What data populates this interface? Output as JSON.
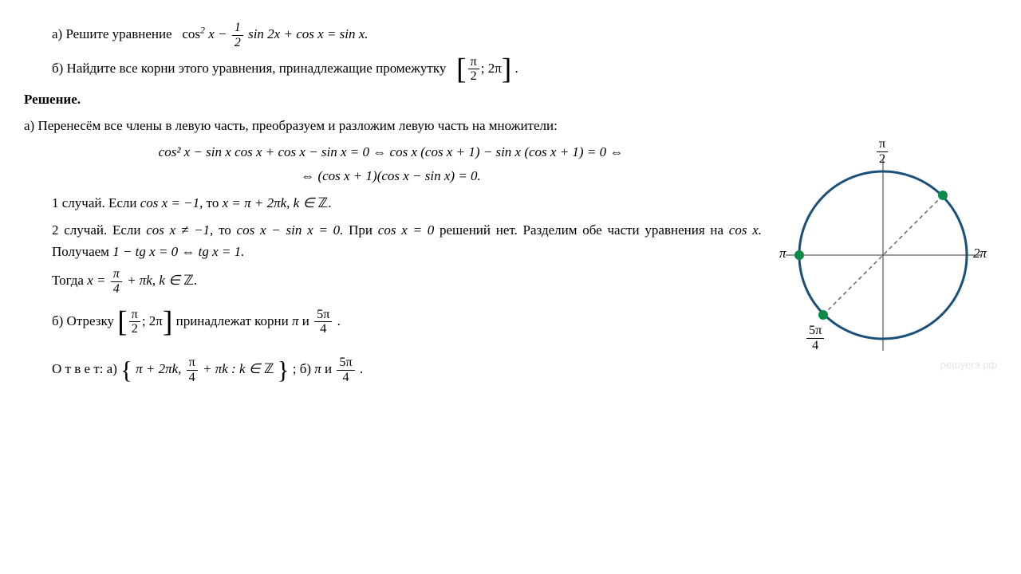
{
  "problem": {
    "a_prefix": "а) Решите уравнение",
    "a_eq_lhs1": "cos",
    "a_eq_sup": "2",
    "a_eq_mid": " x − ",
    "a_eq_frac_num": "1",
    "a_eq_frac_den": "2",
    "a_eq_rest": " sin 2x + cos x = sin x.",
    "b_text": "б) Найдите все корни этого уравнения, принадлежащие промежутку",
    "b_int_num": "π",
    "b_int_den": "2",
    "b_int_sep": "; 2π"
  },
  "solution": {
    "heading": "Решение.",
    "a_intro": "а) Перенесём все члены в левую часть, преобразуем и разложим левую часть на множители:",
    "eqline1": "cos² x − sin x cos x + cos x − sin x = 0 ⇔ cos x (cos x + 1) − sin x (cos x + 1) = 0 ⇔",
    "eqline2": "⇔ (cos x + 1)(cos x − sin x) = 0.",
    "case1_a": "1 случай. Если ",
    "case1_b": "cos x = −1,",
    "case1_c": " то ",
    "case1_d": "x = π + 2πk,  k ∈ ",
    "case1_z": "ℤ.",
    "case2_a": "2 случай. Если ",
    "case2_b": "cos x ≠ −1,",
    "case2_c": " то ",
    "case2_d": "cos x − sin x = 0.",
    "case2_e": " При ",
    "case2_f": "cos x = 0",
    "case2_g": " решений нет. Разделим обе части уравнения на ",
    "case2_h": "cos x.",
    "case2_i": " Получаем ",
    "case2_j": "1 − tg x = 0 ⇔ tg x = 1.",
    "then_a": "Тогда ",
    "then_b": "x = ",
    "then_num": "π",
    "then_den": "4",
    "then_c": " + πk,  k ∈ ",
    "then_z": "ℤ.",
    "b_part_a": "б) Отрезку ",
    "b_part_num": "π",
    "b_part_den": "2",
    "b_part_b": "; 2π",
    "b_part_c": " принадлежат корни ",
    "b_part_d": "π",
    "b_part_e": " и ",
    "b_root2_num": "5π",
    "b_root2_den": "4",
    "answer_label": "О т в е т:  а) ",
    "answer_set1": "π + 2πk,  ",
    "answer_frac_num": "π",
    "answer_frac_den": "4",
    "answer_set2": " + πk :  k ∈ ",
    "answer_z": "ℤ",
    "answer_b": "; б) ",
    "answer_b1": "π",
    "answer_b2": " и ",
    "answer_b3_num": "5π",
    "answer_b3_den": "4"
  },
  "circle": {
    "top": "π",
    "top_den": "2",
    "left": "π",
    "right": "2π",
    "bottom_num": "5π",
    "bottom_den": "4"
  },
  "watermark": "решуегэ.рф"
}
